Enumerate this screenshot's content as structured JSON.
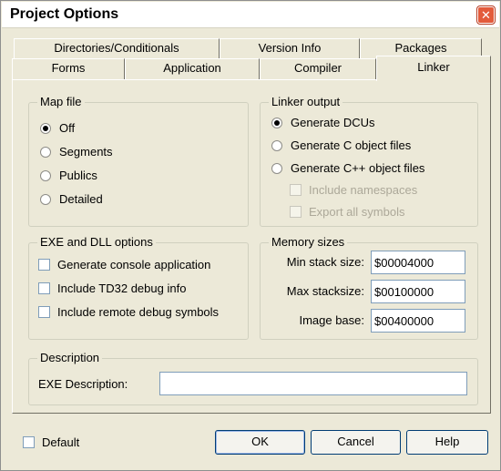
{
  "window": {
    "title": "Project Options",
    "close_glyph": "✕"
  },
  "tabs": {
    "row_back": [
      "Directories/Conditionals",
      "Version Info",
      "Packages"
    ],
    "row_front": [
      "Forms",
      "Application",
      "Compiler",
      "Linker"
    ],
    "active": "Linker"
  },
  "map_file": {
    "legend": "Map file",
    "options": [
      "Off",
      "Segments",
      "Publics",
      "Detailed"
    ],
    "selected": "Off"
  },
  "linker_output": {
    "legend": "Linker output",
    "options": [
      "Generate DCUs",
      "Generate C object files",
      "Generate C++ object files"
    ],
    "selected": "Generate DCUs",
    "sub_options": [
      "Include namespaces",
      "Export all symbols"
    ]
  },
  "exe_dll": {
    "legend": "EXE and DLL options",
    "options": [
      "Generate console application",
      "Include TD32 debug info",
      "Include remote debug symbols"
    ]
  },
  "memory": {
    "legend": "Memory sizes",
    "min_stack_label": "Min stack size:",
    "min_stack_value": "$00004000",
    "max_stack_label": "Max stacksize:",
    "max_stack_value": "$00100000",
    "image_base_label": "Image base:",
    "image_base_value": "$00400000"
  },
  "description": {
    "legend": "Description",
    "exe_label": "EXE Description:",
    "exe_value": ""
  },
  "footer": {
    "default_label": "Default",
    "ok": "OK",
    "cancel": "Cancel",
    "help": "Help"
  },
  "colors": {
    "face": "#ece9d8",
    "close_button": "#e35b3b",
    "field_border": "#7f9db9",
    "button_border": "#003c74",
    "disabled_text": "#aca899"
  }
}
